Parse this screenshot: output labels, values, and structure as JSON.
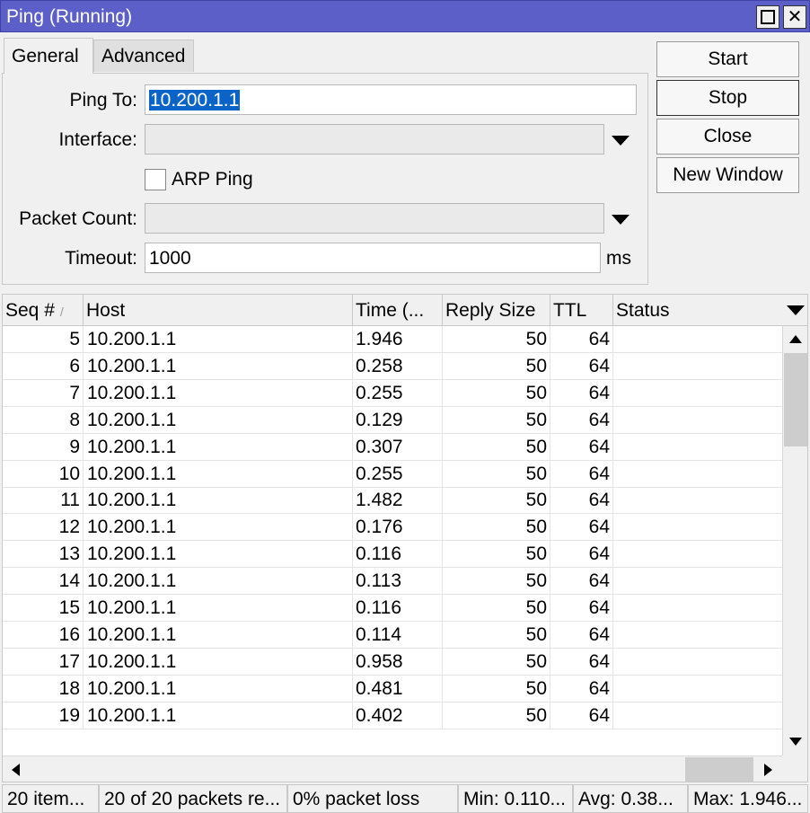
{
  "window": {
    "title": "Ping (Running)"
  },
  "tabs": [
    {
      "label": "General"
    },
    {
      "label": "Advanced"
    }
  ],
  "form": {
    "ping_to": {
      "label": "Ping To:",
      "value": "10.200.1.1"
    },
    "interface": {
      "label": "Interface:",
      "value": ""
    },
    "arp_ping": {
      "label": "ARP Ping",
      "checked": false
    },
    "packet_count": {
      "label": "Packet Count:",
      "value": ""
    },
    "timeout": {
      "label": "Timeout:",
      "value": "1000",
      "unit": "ms"
    }
  },
  "buttons": {
    "start": "Start",
    "stop": "Stop",
    "close": "Close",
    "new_window": "New Window"
  },
  "table": {
    "columns": [
      "Seq #",
      "Host",
      "Time (...",
      "Reply Size",
      "TTL",
      "Status"
    ],
    "sort_indicator": "/",
    "rows": [
      {
        "seq": "5",
        "host": "10.200.1.1",
        "time": "1.946",
        "size": "50",
        "ttl": "64",
        "status": ""
      },
      {
        "seq": "6",
        "host": "10.200.1.1",
        "time": "0.258",
        "size": "50",
        "ttl": "64",
        "status": ""
      },
      {
        "seq": "7",
        "host": "10.200.1.1",
        "time": "0.255",
        "size": "50",
        "ttl": "64",
        "status": ""
      },
      {
        "seq": "8",
        "host": "10.200.1.1",
        "time": "0.129",
        "size": "50",
        "ttl": "64",
        "status": ""
      },
      {
        "seq": "9",
        "host": "10.200.1.1",
        "time": "0.307",
        "size": "50",
        "ttl": "64",
        "status": ""
      },
      {
        "seq": "10",
        "host": "10.200.1.1",
        "time": "0.255",
        "size": "50",
        "ttl": "64",
        "status": ""
      },
      {
        "seq": "11",
        "host": "10.200.1.1",
        "time": "1.482",
        "size": "50",
        "ttl": "64",
        "status": ""
      },
      {
        "seq": "12",
        "host": "10.200.1.1",
        "time": "0.176",
        "size": "50",
        "ttl": "64",
        "status": ""
      },
      {
        "seq": "13",
        "host": "10.200.1.1",
        "time": "0.116",
        "size": "50",
        "ttl": "64",
        "status": ""
      },
      {
        "seq": "14",
        "host": "10.200.1.1",
        "time": "0.113",
        "size": "50",
        "ttl": "64",
        "status": ""
      },
      {
        "seq": "15",
        "host": "10.200.1.1",
        "time": "0.116",
        "size": "50",
        "ttl": "64",
        "status": ""
      },
      {
        "seq": "16",
        "host": "10.200.1.1",
        "time": "0.114",
        "size": "50",
        "ttl": "64",
        "status": ""
      },
      {
        "seq": "17",
        "host": "10.200.1.1",
        "time": "0.958",
        "size": "50",
        "ttl": "64",
        "status": ""
      },
      {
        "seq": "18",
        "host": "10.200.1.1",
        "time": "0.481",
        "size": "50",
        "ttl": "64",
        "status": ""
      },
      {
        "seq": "19",
        "host": "10.200.1.1",
        "time": "0.402",
        "size": "50",
        "ttl": "64",
        "status": ""
      }
    ]
  },
  "status_bar": {
    "items": "20 item...",
    "packets": "20 of 20 packets re...",
    "loss": "0% packet loss",
    "min": "Min: 0.110...",
    "avg": "Avg: 0.38...",
    "max": "Max: 1.946..."
  },
  "colors": {
    "titlebar": "#5b5fc7",
    "selection": "#0a64c8"
  }
}
